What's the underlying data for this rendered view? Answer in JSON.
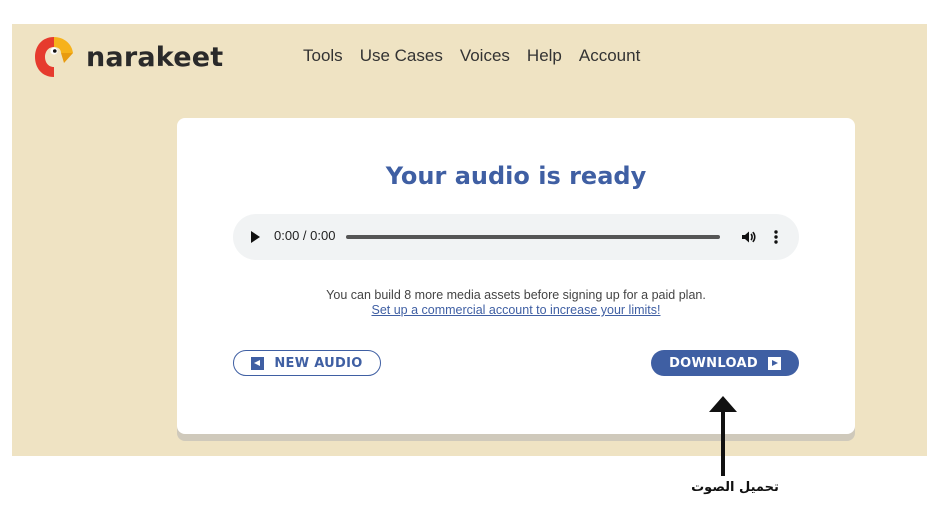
{
  "header": {
    "brand": "narakeet",
    "nav": [
      "Tools",
      "Use Cases",
      "Voices",
      "Help",
      "Account"
    ]
  },
  "card": {
    "title": "Your audio is ready",
    "player": {
      "time": "0:00 / 0:00",
      "progress": 0
    },
    "info_text": "You can build 8 more media assets before signing up for a paid plan.",
    "info_link": "Set up a commercial account to increase your limits!",
    "new_audio_label": "NEW AUDIO",
    "download_label": "DOWNLOAD"
  },
  "annotation": {
    "caption": "تحميل الصوت"
  },
  "colors": {
    "accent": "#3f5fa3",
    "background": "#efe3c3",
    "logo_red": "#e63b2e",
    "logo_yellow": "#f6b21b"
  }
}
